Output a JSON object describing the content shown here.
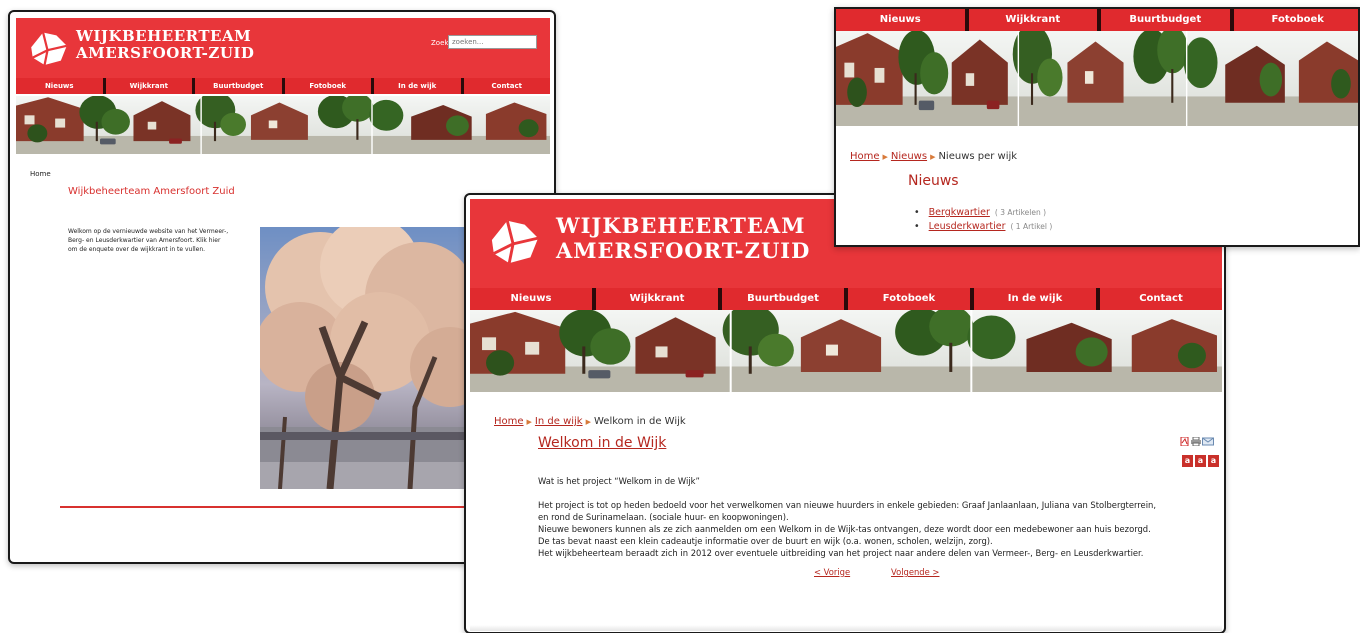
{
  "site": {
    "title_line1": "WIJKBEHEERTEAM",
    "title_line2": "AMERSFOORT-ZUID",
    "brand_color": "#e8363a",
    "link_color": "#b5271f"
  },
  "nav": [
    "Nieuws",
    "Wijkkrant",
    "Buurtbudget",
    "Fotoboek",
    "In de wijk",
    "Contact"
  ],
  "frame_a": {
    "search_label": "Zoek:",
    "search_placeholder": "zoeken...",
    "breadcrumb": "Home",
    "heading": "Wijkbeheerteam Amersfoort Zuid",
    "body_lines": [
      "Welkom op de vernieuwde website van het Vermeer-,",
      "Berg- en Leusderkwartier van Amersfoort. Klik hier",
      "om de enquete over de wijkkrant in te vullen."
    ]
  },
  "frame_b": {
    "nav": [
      "Nieuws",
      "Wijkkrant",
      "Buurtbudget",
      "Fotoboek"
    ],
    "breadcrumb": {
      "home": "Home",
      "section": "Nieuws",
      "current": "Nieuws per wijk"
    },
    "heading": "Nieuws",
    "categories": [
      {
        "name": "Bergkwartier",
        "count": "( 3 Artikelen )"
      },
      {
        "name": "Leusderkwartier",
        "count": "( 1 Artikel )"
      }
    ]
  },
  "frame_c": {
    "breadcrumb": {
      "home": "Home",
      "section": "In de wijk",
      "current": "Welkom in de Wijk"
    },
    "heading": "Welkom in de Wijk",
    "tool_icons": [
      "pdf-icon",
      "print-icon",
      "email-icon"
    ],
    "font_buttons": [
      "a",
      "a",
      "a"
    ],
    "intro": "Wat is het project “Welkom in de Wijk”",
    "paragraphs": [
      "Het project is tot op heden bedoeld voor het verwelkomen van nieuwe huurders in enkele gebieden: Graaf Janlaanlaan, Juliana van Stolbergterrein,",
      "en rond de Surinamelaan. (sociale huur- en koopwoningen).",
      "Nieuwe bewoners kunnen als ze zich aanmelden om een Welkom in de Wijk-tas ontvangen, deze wordt door een medebewoner aan huis bezorgd.",
      "De tas bevat naast een klein cadeautje informatie over de buurt en wijk (o.a. wonen, scholen, welzijn, zorg).",
      "Het wijkbeheerteam beraadt zich in 2012 over eventuele uitbreiding van het project naar andere delen van Vermeer-, Berg- en Leusderkwartier."
    ],
    "prev": "< Vorige",
    "next": "Volgende >"
  }
}
